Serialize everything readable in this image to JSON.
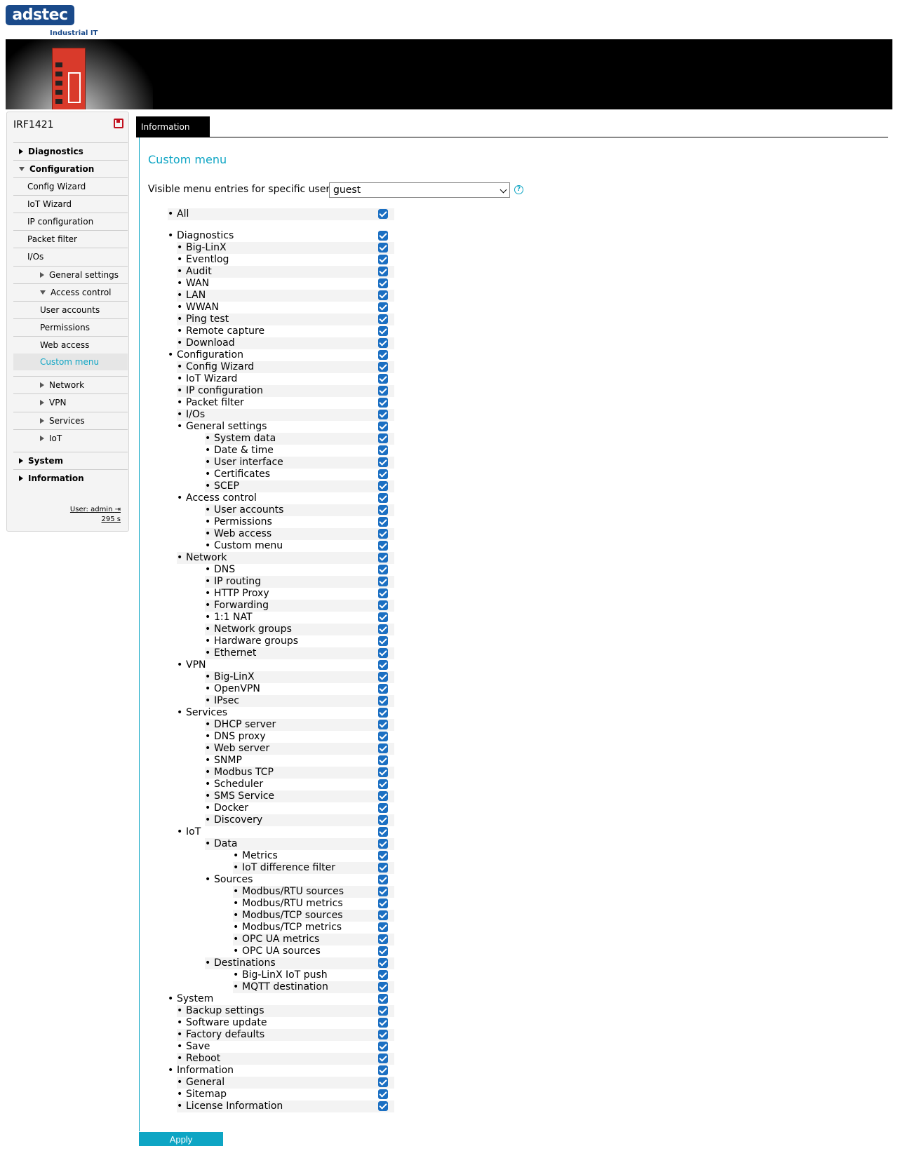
{
  "brand": {
    "logo_text": "adstec",
    "tagline": "Industrial IT"
  },
  "device_name": "IRF1421",
  "sidebar": {
    "items": [
      {
        "label": "Diagnostics",
        "level": 0,
        "expander": "collapsed",
        "bold": true
      },
      {
        "label": "Configuration",
        "level": 0,
        "expander": "expanded",
        "bold": true
      },
      {
        "label": "Config Wizard",
        "level": 1
      },
      {
        "label": "IoT Wizard",
        "level": 1
      },
      {
        "label": "IP configuration",
        "level": 1
      },
      {
        "label": "Packet filter",
        "level": 1
      },
      {
        "label": "I/Os",
        "level": 1
      },
      {
        "label": "General settings",
        "level": 2,
        "expander": "collapsed"
      },
      {
        "label": "Access control",
        "level": 2,
        "expander": "expanded"
      },
      {
        "label": "User accounts",
        "level": 3
      },
      {
        "label": "Permissions",
        "level": 3
      },
      {
        "label": "Web access",
        "level": 3
      },
      {
        "label": "Custom menu",
        "level": 3,
        "active": true
      },
      {
        "label": "Network",
        "level": 2,
        "expander": "collapsed"
      },
      {
        "label": "VPN",
        "level": 2,
        "expander": "collapsed"
      },
      {
        "label": "Services",
        "level": 2,
        "expander": "collapsed"
      },
      {
        "label": "IoT",
        "level": 2,
        "expander": "collapsed"
      },
      {
        "label": "System",
        "level": 0,
        "expander": "collapsed",
        "bold": true
      },
      {
        "label": "Information",
        "level": 0,
        "expander": "collapsed",
        "bold": true
      }
    ],
    "user": "User: admin",
    "timeout": "295 s"
  },
  "tab_label": "Information",
  "heading": "Custom menu",
  "user_select": {
    "label": "Visible menu entries for specific users",
    "value": "guest"
  },
  "entries": [
    {
      "label": "All",
      "level": 0,
      "checked": true
    },
    {
      "label": "Diagnostics",
      "level": 0,
      "checked": true
    },
    {
      "label": "Big-LinX",
      "level": 1,
      "checked": true
    },
    {
      "label": "Eventlog",
      "level": 1,
      "checked": true
    },
    {
      "label": "Audit",
      "level": 1,
      "checked": true
    },
    {
      "label": "WAN",
      "level": 1,
      "checked": true
    },
    {
      "label": "LAN",
      "level": 1,
      "checked": true
    },
    {
      "label": "WWAN",
      "level": 1,
      "checked": true
    },
    {
      "label": "Ping test",
      "level": 1,
      "checked": true
    },
    {
      "label": "Remote capture",
      "level": 1,
      "checked": true
    },
    {
      "label": "Download",
      "level": 1,
      "checked": true
    },
    {
      "label": "Configuration",
      "level": 0,
      "checked": true
    },
    {
      "label": "Config Wizard",
      "level": 1,
      "checked": true
    },
    {
      "label": "IoT Wizard",
      "level": 1,
      "checked": true
    },
    {
      "label": "IP configuration",
      "level": 1,
      "checked": true
    },
    {
      "label": "Packet filter",
      "level": 1,
      "checked": true
    },
    {
      "label": "I/Os",
      "level": 1,
      "checked": true
    },
    {
      "label": "General settings",
      "level": 1,
      "checked": true
    },
    {
      "label": "System data",
      "level": 2,
      "checked": true
    },
    {
      "label": "Date & time",
      "level": 2,
      "checked": true
    },
    {
      "label": "User interface",
      "level": 2,
      "checked": true
    },
    {
      "label": "Certificates",
      "level": 2,
      "checked": true
    },
    {
      "label": "SCEP",
      "level": 2,
      "checked": true
    },
    {
      "label": "Access control",
      "level": 1,
      "checked": true
    },
    {
      "label": "User accounts",
      "level": 2,
      "checked": true
    },
    {
      "label": "Permissions",
      "level": 2,
      "checked": true
    },
    {
      "label": "Web access",
      "level": 2,
      "checked": true
    },
    {
      "label": "Custom menu",
      "level": 2,
      "checked": true
    },
    {
      "label": "Network",
      "level": 1,
      "checked": true
    },
    {
      "label": "DNS",
      "level": 2,
      "checked": true
    },
    {
      "label": "IP routing",
      "level": 2,
      "checked": true
    },
    {
      "label": "HTTP Proxy",
      "level": 2,
      "checked": true
    },
    {
      "label": "Forwarding",
      "level": 2,
      "checked": true
    },
    {
      "label": "1:1 NAT",
      "level": 2,
      "checked": true
    },
    {
      "label": "Network groups",
      "level": 2,
      "checked": true
    },
    {
      "label": "Hardware groups",
      "level": 2,
      "checked": true
    },
    {
      "label": "Ethernet",
      "level": 2,
      "checked": true
    },
    {
      "label": "VPN",
      "level": 1,
      "checked": true
    },
    {
      "label": "Big-LinX",
      "level": 2,
      "checked": true
    },
    {
      "label": "OpenVPN",
      "level": 2,
      "checked": true
    },
    {
      "label": "IPsec",
      "level": 2,
      "checked": true
    },
    {
      "label": "Services",
      "level": 1,
      "checked": true
    },
    {
      "label": "DHCP server",
      "level": 2,
      "checked": true
    },
    {
      "label": "DNS proxy",
      "level": 2,
      "checked": true
    },
    {
      "label": "Web server",
      "level": 2,
      "checked": true
    },
    {
      "label": "SNMP",
      "level": 2,
      "checked": true
    },
    {
      "label": "Modbus TCP",
      "level": 2,
      "checked": true
    },
    {
      "label": "Scheduler",
      "level": 2,
      "checked": true
    },
    {
      "label": "SMS Service",
      "level": 2,
      "checked": true
    },
    {
      "label": "Docker",
      "level": 2,
      "checked": true
    },
    {
      "label": "Discovery",
      "level": 2,
      "checked": true
    },
    {
      "label": "IoT",
      "level": 1,
      "checked": true
    },
    {
      "label": "Data",
      "level": 2,
      "checked": true
    },
    {
      "label": "Metrics",
      "level": 3,
      "checked": true
    },
    {
      "label": "IoT difference filter",
      "level": 3,
      "checked": true
    },
    {
      "label": "Sources",
      "level": 2,
      "checked": true
    },
    {
      "label": "Modbus/RTU sources",
      "level": 3,
      "checked": true
    },
    {
      "label": "Modbus/RTU metrics",
      "level": 3,
      "checked": true
    },
    {
      "label": "Modbus/TCP sources",
      "level": 3,
      "checked": true
    },
    {
      "label": "Modbus/TCP metrics",
      "level": 3,
      "checked": true
    },
    {
      "label": "OPC UA metrics",
      "level": 3,
      "checked": true
    },
    {
      "label": "OPC UA sources",
      "level": 3,
      "checked": true
    },
    {
      "label": "Destinations",
      "level": 2,
      "checked": true
    },
    {
      "label": "Big-LinX IoT push",
      "level": 3,
      "checked": true
    },
    {
      "label": "MQTT destination",
      "level": 3,
      "checked": true
    },
    {
      "label": "System",
      "level": 0,
      "checked": true
    },
    {
      "label": "Backup settings",
      "level": 1,
      "checked": true
    },
    {
      "label": "Software update",
      "level": 1,
      "checked": true
    },
    {
      "label": "Factory defaults",
      "level": 1,
      "checked": true
    },
    {
      "label": "Save",
      "level": 1,
      "checked": true
    },
    {
      "label": "Reboot",
      "level": 1,
      "checked": true
    },
    {
      "label": "Information",
      "level": 0,
      "checked": true
    },
    {
      "label": "General",
      "level": 1,
      "checked": true
    },
    {
      "label": "Sitemap",
      "level": 1,
      "checked": true
    },
    {
      "label": "License Information",
      "level": 1,
      "checked": true
    }
  ],
  "apply_label": "Apply",
  "colors": {
    "accent": "#0ea5c4",
    "checkbox": "#1b6fc2",
    "brand_red": "#c0101e",
    "brand_blue": "#1a4a8a"
  }
}
